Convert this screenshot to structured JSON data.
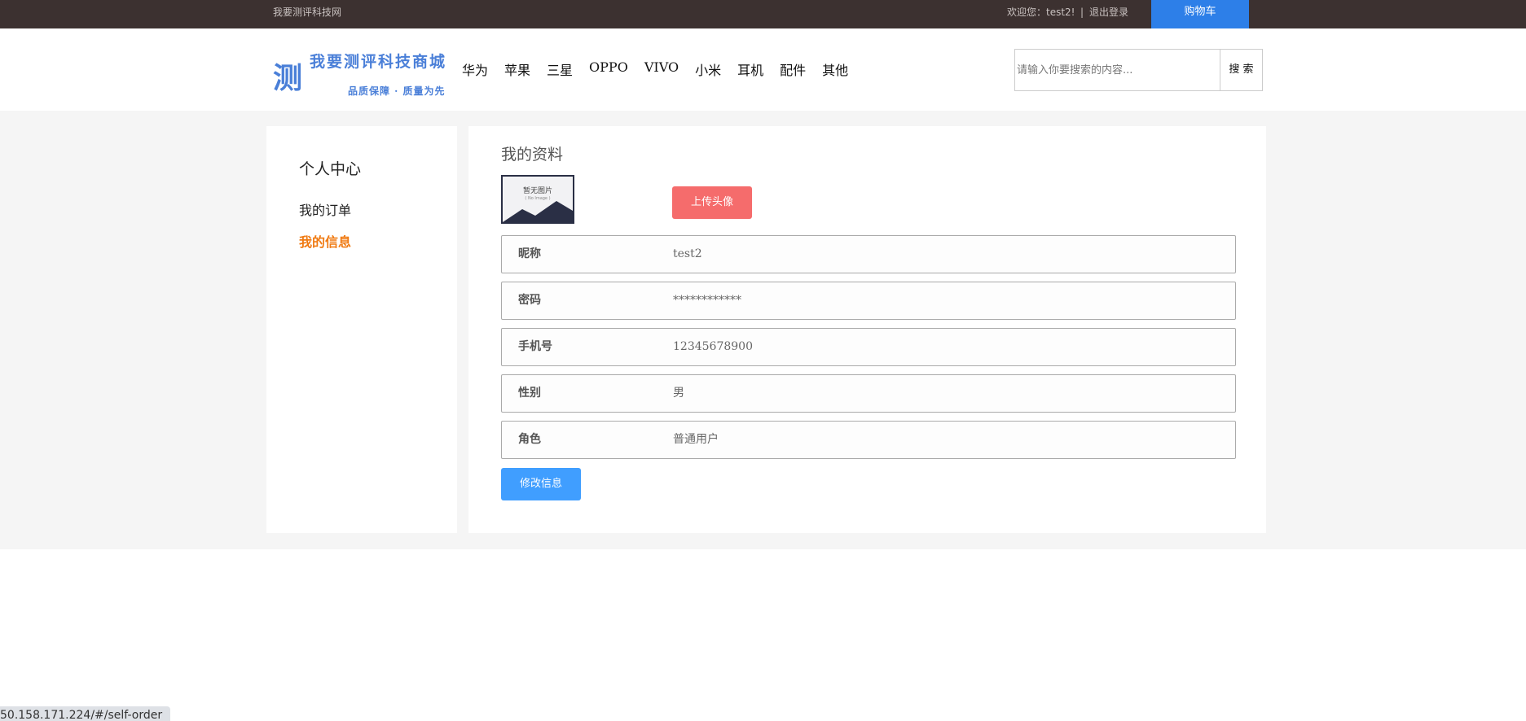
{
  "topbar": {
    "site_name": "我要测评科技网",
    "welcome": "欢迎您：test2!",
    "separator": "|",
    "logout": "退出登录",
    "cart": "购物车"
  },
  "header": {
    "logo_char": "测",
    "logo_name": "我要测评科技商城",
    "logo_slogan": "品质保障 · 质量为先",
    "nav": [
      "华为",
      "苹果",
      "三星",
      "OPPO",
      "VIVO",
      "小米",
      "耳机",
      "配件",
      "其他"
    ],
    "search_placeholder": "请输入你要搜索的内容...",
    "search_button": "搜 索"
  },
  "sidebar": {
    "title": "个人中心",
    "items": [
      {
        "label": "我的订单",
        "active": false
      },
      {
        "label": "我的信息",
        "active": true
      }
    ]
  },
  "profile": {
    "title": "我的资料",
    "avatar_text": "暂无图片",
    "avatar_sub": "( No Image )",
    "upload_button": "上传头像",
    "fields": [
      {
        "label": "昵称",
        "value": "test2"
      },
      {
        "label": "密码",
        "value": "************"
      },
      {
        "label": "手机号",
        "value": "12345678900"
      },
      {
        "label": "性别",
        "value": "男"
      },
      {
        "label": "角色",
        "value": "普通用户"
      }
    ],
    "edit_button": "修改信息"
  },
  "status_url": "50.158.171.224/#/self-order",
  "colors": {
    "topbar_bg": "#3c3130",
    "cart_bg": "#2d7fe8",
    "logo": "#4a7fd8",
    "active_menu": "#f07a12",
    "upload_btn": "#f56c6c",
    "edit_btn": "#409eff"
  }
}
